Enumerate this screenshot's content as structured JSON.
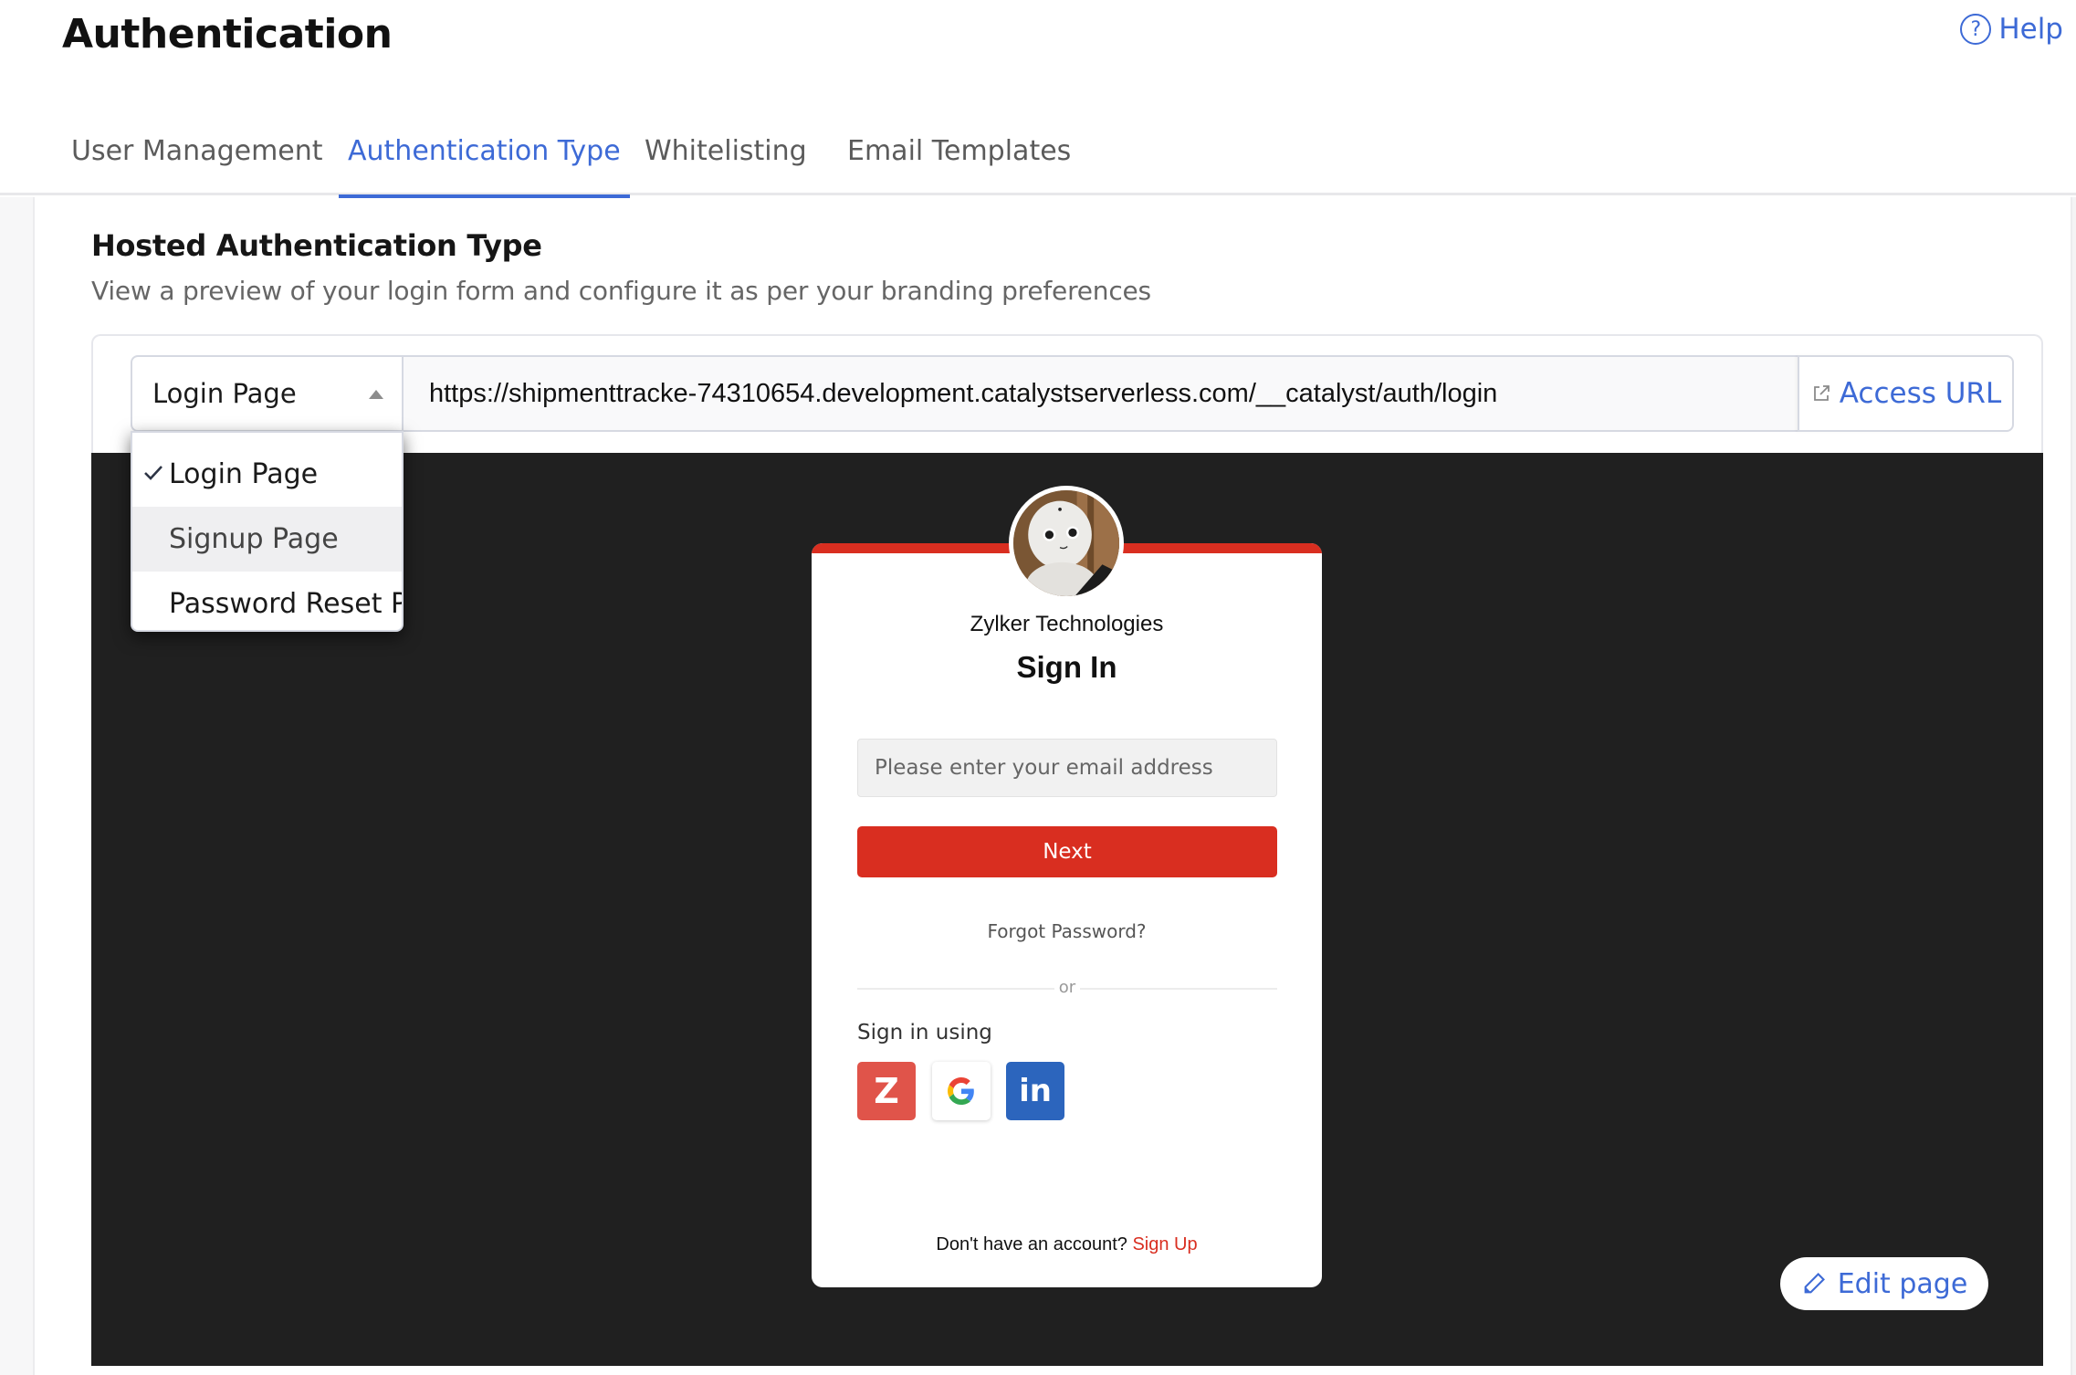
{
  "header": {
    "title": "Authentication",
    "help_label": "Help",
    "help_icon": "question-circle-icon"
  },
  "tabs": [
    {
      "label": "User Management",
      "active": false
    },
    {
      "label": "Authentication Type",
      "active": true
    },
    {
      "label": "Whitelisting",
      "active": false
    },
    {
      "label": "Email Templates",
      "active": false
    }
  ],
  "section": {
    "title": "Hosted Authentication Type",
    "description": "View a preview of your login form and configure it as per your branding preferences"
  },
  "page_select": {
    "selected": "Login Page",
    "options": [
      {
        "label": "Login Page",
        "checked": true
      },
      {
        "label": "Signup Page",
        "checked": false,
        "hovered": true
      },
      {
        "label": "Password Reset P...",
        "checked": false
      }
    ]
  },
  "url_bar": {
    "value": "https://shipmenttracke-74310654.development.catalystserverless.com/__catalyst/auth/login",
    "access_label": "Access URL",
    "access_icon": "external-link-icon"
  },
  "login_preview": {
    "org_name": "Zylker Technologies",
    "title": "Sign In",
    "email_placeholder": "Please enter your email address",
    "next_label": "Next",
    "forgot_label": "Forgot Password?",
    "divider_label": "or",
    "signin_using_label": "Sign in using",
    "social_providers": [
      {
        "name": "Zoho",
        "glyph": "Z"
      },
      {
        "name": "Google",
        "glyph": "G"
      },
      {
        "name": "LinkedIn",
        "glyph": "in"
      }
    ],
    "no_account_text": "Don't have an account?",
    "signup_label": "Sign Up",
    "accent_color": "#d92e20"
  },
  "edit_page_label": "Edit page",
  "colors": {
    "brand_blue": "#3d6ad6",
    "preview_background": "#202020"
  }
}
